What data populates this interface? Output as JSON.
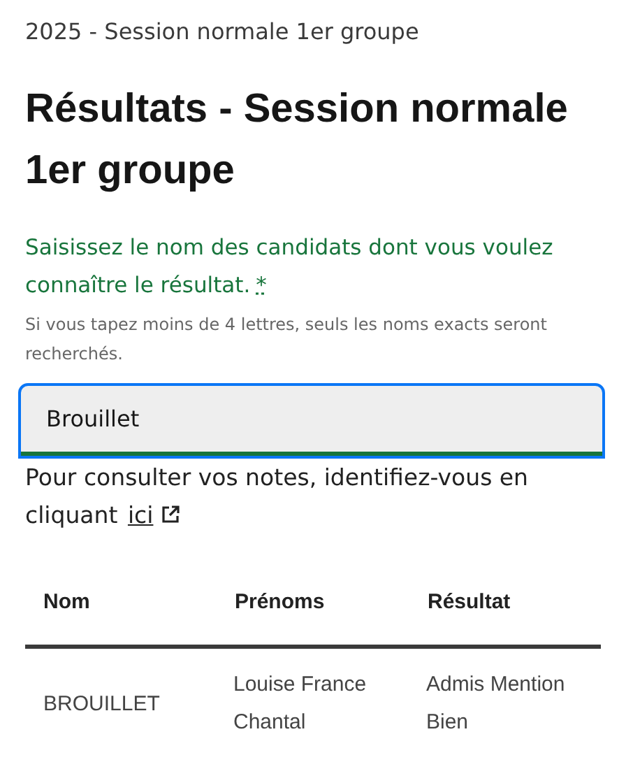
{
  "breadcrumb": "2025 - Session normale 1er groupe",
  "title": "Résultats - Session normale 1er groupe",
  "search": {
    "label": "Saisissez le nom des candidats dont vous voulez connaître le résultat.",
    "required_mark": "*",
    "hint": "Si vous tapez moins de 4 lettres, seuls les noms exacts seront recherchés.",
    "value": "Brouillet",
    "focused": true
  },
  "login_note": {
    "text": "Pour consulter vos notes, identifiez-vous en cliquant",
    "link": "ici"
  },
  "table": {
    "columns": [
      "Nom",
      "Prénoms",
      "Résultat"
    ],
    "rows": [
      [
        "BROUILLET",
        "Louise France Chantal",
        "Admis Mention Bien"
      ]
    ]
  }
}
